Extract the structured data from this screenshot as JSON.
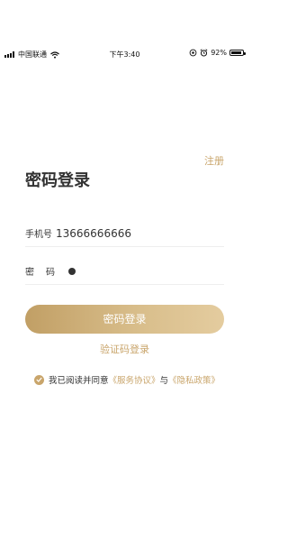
{
  "status_bar": {
    "carrier": "中国联通",
    "time": "下午3:40",
    "battery_percent": "92%",
    "battery_level": 0.92
  },
  "header": {
    "register_label": "注册",
    "title": "密码登录"
  },
  "form": {
    "phone_label": "手机号",
    "phone_value": "13666666666",
    "password_label": "密码"
  },
  "actions": {
    "login_label": "密码登录",
    "sms_login_label": "验证码登录"
  },
  "agreement": {
    "prefix": "我已阅读并同意",
    "service_link": "《服务协议》",
    "connector": "与",
    "privacy_link": "《隐私政策》",
    "checked": true
  },
  "colors": {
    "accent": "#c9a56b",
    "text": "#333333"
  }
}
